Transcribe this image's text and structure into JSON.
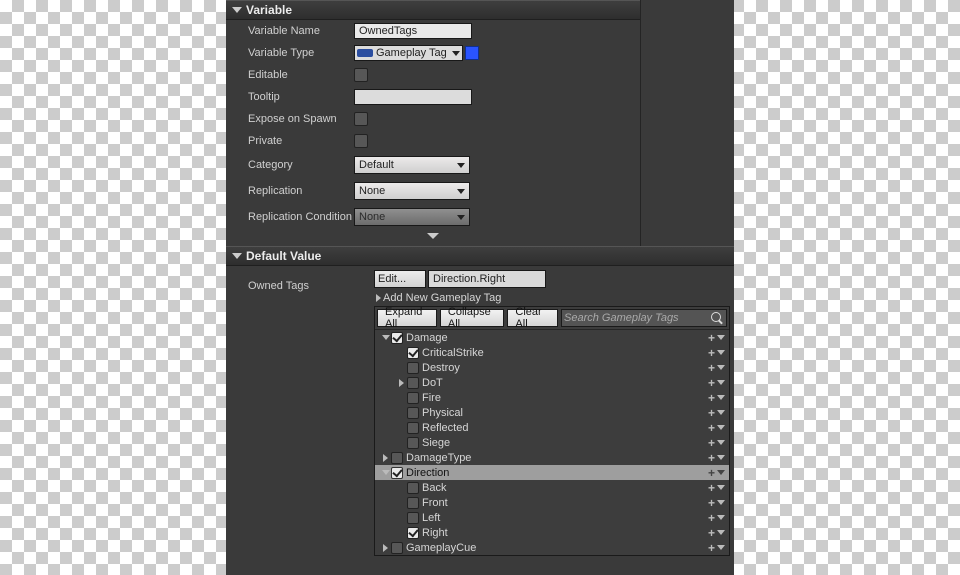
{
  "sections": {
    "variable": "Variable",
    "defaultValue": "Default Value"
  },
  "props": {
    "variableName": {
      "label": "Variable Name",
      "value": "OwnedTags"
    },
    "variableType": {
      "label": "Variable Type",
      "value": "Gameplay Tag"
    },
    "editable": {
      "label": "Editable"
    },
    "tooltip": {
      "label": "Tooltip",
      "value": ""
    },
    "exposeOnSpawn": {
      "label": "Expose on Spawn"
    },
    "private_": {
      "label": "Private"
    },
    "category": {
      "label": "Category",
      "value": "Default"
    },
    "replication": {
      "label": "Replication",
      "value": "None"
    },
    "replicationCondition": {
      "label": "Replication Condition",
      "value": "None"
    }
  },
  "owned": {
    "label": "Owned Tags",
    "editLabel": "Edit...",
    "path": "Direction.Right",
    "addNew": "Add New Gameplay Tag"
  },
  "toolbar": {
    "expand": "Expand All",
    "collapse": "Collapse All",
    "clear": "Clear All",
    "searchPlaceholder": "Search Gameplay Tags"
  },
  "tree": [
    {
      "depth": 0,
      "expander": "open",
      "checked": true,
      "label": "Damage"
    },
    {
      "depth": 1,
      "expander": "none",
      "checked": true,
      "label": "CriticalStrike"
    },
    {
      "depth": 1,
      "expander": "none",
      "checked": false,
      "label": "Destroy"
    },
    {
      "depth": 1,
      "expander": "closed",
      "checked": false,
      "label": "DoT"
    },
    {
      "depth": 1,
      "expander": "none",
      "checked": false,
      "label": "Fire"
    },
    {
      "depth": 1,
      "expander": "none",
      "checked": false,
      "label": "Physical"
    },
    {
      "depth": 1,
      "expander": "none",
      "checked": false,
      "label": "Reflected"
    },
    {
      "depth": 1,
      "expander": "none",
      "checked": false,
      "label": "Siege"
    },
    {
      "depth": 0,
      "expander": "closed",
      "checked": false,
      "label": "DamageType"
    },
    {
      "depth": 0,
      "expander": "open",
      "checked": true,
      "label": "Direction",
      "selected": true
    },
    {
      "depth": 1,
      "expander": "none",
      "checked": false,
      "label": "Back"
    },
    {
      "depth": 1,
      "expander": "none",
      "checked": false,
      "label": "Front"
    },
    {
      "depth": 1,
      "expander": "none",
      "checked": false,
      "label": "Left"
    },
    {
      "depth": 1,
      "expander": "none",
      "checked": true,
      "label": "Right"
    },
    {
      "depth": 0,
      "expander": "closed",
      "checked": false,
      "label": "GameplayCue"
    }
  ]
}
